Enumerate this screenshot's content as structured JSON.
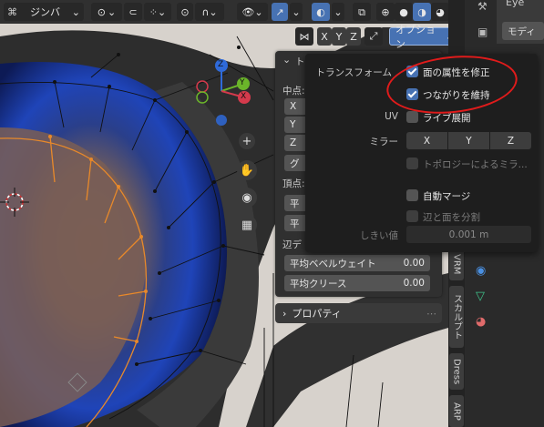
{
  "header": {
    "pivot_label": "ジンバ",
    "options_label": "オプション",
    "mirror_axes": [
      "X",
      "Y",
      "Z"
    ]
  },
  "n_panel": {
    "tab_title_partial": "ト",
    "median_label": "中点:",
    "median_fields": [
      "X",
      "Y",
      "Z"
    ],
    "global_partial": "グ",
    "vertex_label": "頂点:",
    "vertex_fields": [
      "平",
      "平"
    ],
    "edge_label": "辺デ",
    "bevel_weight_label": "平均ベベルウェイト",
    "bevel_weight_value": "0.00",
    "crease_label": "平均クリース",
    "crease_value": "0.00"
  },
  "properties_panel": {
    "title": "プロパティ"
  },
  "options_popover": {
    "transform_label": "トランスフォーム",
    "correct_face_attributes": {
      "label": "面の属性を修正",
      "checked": true
    },
    "keep_connected": {
      "label": "つながりを維持",
      "checked": true
    },
    "uv_label": "UV",
    "live_unwrap": {
      "label": "ライブ展開",
      "checked": false
    },
    "mirror_label": "ミラー",
    "mirror_axes": [
      "X",
      "Y",
      "Z"
    ],
    "topology_mirror": {
      "label": "トポロジーによるミラ...",
      "checked": false
    },
    "auto_merge": {
      "label": "自動マージ",
      "checked": false
    },
    "split_edges_faces": {
      "label": "辺と面を分割",
      "checked": false
    },
    "threshold_label": "しきい値",
    "threshold_value": "0.001 m"
  },
  "side_tabs": [
    "VRM",
    "スカルプト",
    "Dress",
    "ARP"
  ],
  "right_panel": {
    "top_partial": "Eye",
    "modifier_partial": "モディ"
  },
  "gizmo": {
    "axes": [
      "Z",
      "Y",
      "X"
    ]
  },
  "colors": {
    "accent_blue": "#4772b3",
    "annotation_red": "#e01b1b",
    "selected_edge_orange": "#e8892a"
  }
}
